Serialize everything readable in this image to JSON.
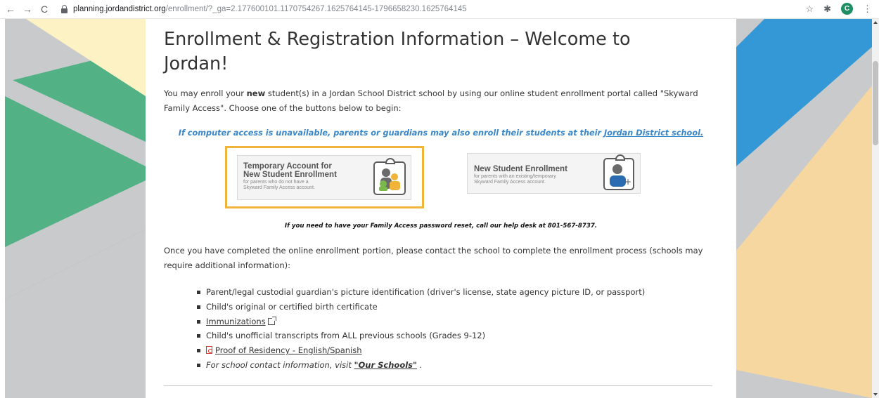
{
  "browser": {
    "url_domain": "planning.jordandistrict.org",
    "url_path": "/enrollment/?_ga=2.177600101.1170754267.1625764145-1796658230.1625764145",
    "profile_initial": "C",
    "back_icon": "arrow-left-icon",
    "forward_icon": "arrow-right-icon",
    "reload_icon": "reload-icon"
  },
  "page": {
    "title": "Enrollment & Registration Information – Welcome to Jordan!",
    "intro_before": "You may enroll your ",
    "intro_bold": "new",
    "intro_after": " student(s) in a Jordan School District school by using our online student enrollment portal called \"Skyward Family Access\". Choose one of the buttons below to begin:",
    "alt_note_text": "If computer access is unavailable, parents or guardians may also enroll their students at their ",
    "alt_note_link": "Jordan District school.",
    "help_note": "If you need to have your Family Access password reset, call our help desk at 801-567-8737.",
    "after_text": "Once you have completed the online enrollment portion, please contact the school to complete the enrollment process (schools may require additional information):"
  },
  "buttons": {
    "temporary": {
      "title_line1": "Temporary Account for",
      "title_line2": "New Student Enrollment",
      "sub_line1": "for parents who do not have a",
      "sub_line2": "Skyward Family Access account."
    },
    "new_student": {
      "title": "New Student Enrollment",
      "sub_line1": "for parents with an existing/temporary",
      "sub_line2": "Skyward Family Access account."
    }
  },
  "requirements": {
    "item1": "Parent/legal custodial guardian's picture identification (driver's license, state agency picture ID, or passport)",
    "item2": "Child's original or certified birth certificate",
    "item3_link": "Immunizations",
    "item4": "Child's unofficial transcripts from ALL previous schools (Grades 9-12)",
    "item5_link": "Proof of Residency - English/Spanish",
    "item6_before": "For school contact information, visit ",
    "item6_link": "\"Our Schools\"",
    "item6_after": " ."
  },
  "colors": {
    "accent_link": "#3a87c8",
    "button_highlight": "#f0b43a",
    "side_yellow": "#fdf2c4",
    "side_green": "#52b185",
    "side_blue": "#3598d6",
    "side_peach": "#f7d7a0",
    "side_gray": "#c9cacc"
  }
}
